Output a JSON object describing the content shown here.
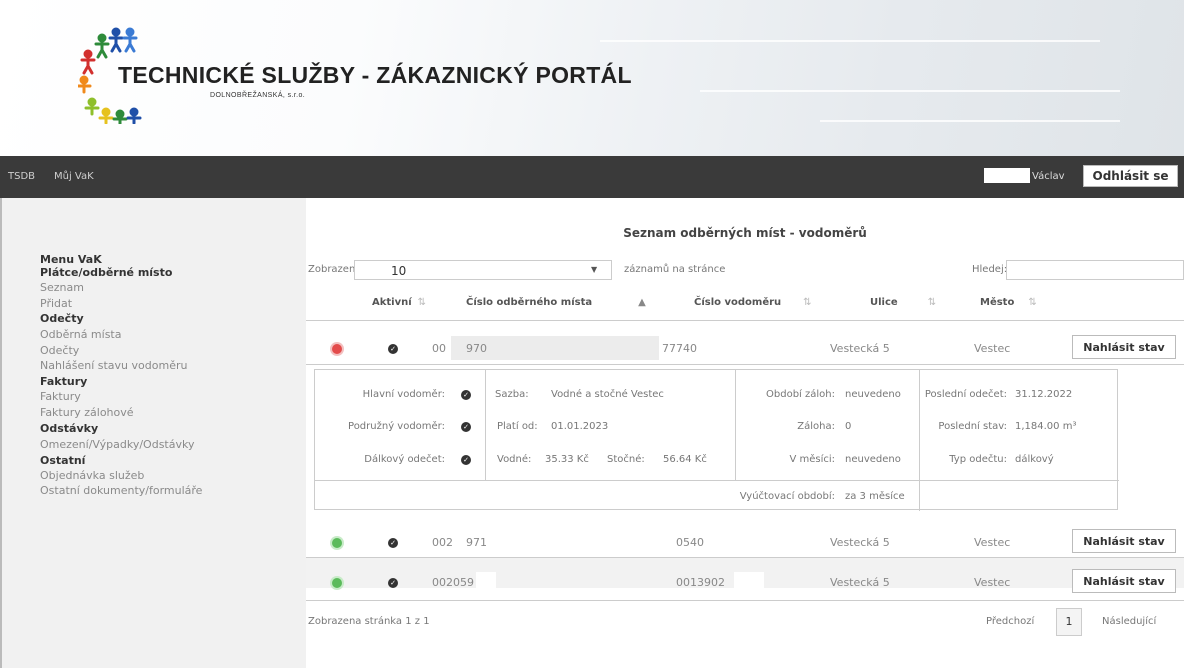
{
  "header": {
    "brand_title": "TECHNICKÉ SLUŽBY - ZÁKAZNICKÝ PORTÁL",
    "brand_subtitle": "DOLNOBŘEŽANSKÁ, s.r.o."
  },
  "navbar": {
    "items": [
      "TSDB",
      "Můj VaK"
    ],
    "user_name": "Václav",
    "logout_label": "Odhlásit se"
  },
  "sidebar": {
    "menu_title": "Menu VaK",
    "sections": [
      {
        "title": "Plátce/odběrné místo",
        "links": [
          "Seznam",
          "Přidat"
        ]
      },
      {
        "title": "Odečty",
        "links": [
          "Odběrná místa",
          "Odečty",
          "Nahlášení stavu vodoměru"
        ]
      },
      {
        "title": "Faktury",
        "links": [
          "Faktury",
          "Faktury zálohové"
        ]
      },
      {
        "title": "Odstávky",
        "links": [
          "Omezení/Výpadky/Odstávky"
        ]
      },
      {
        "title": "Ostatní",
        "links": [
          "Objednávka služeb",
          "Ostatní dokumenty/formuláře"
        ]
      }
    ]
  },
  "main": {
    "title": "Seznam odběrných míst - vodoměrů",
    "length": {
      "prefix": "Zobrazeno",
      "value": "10",
      "suffix": "záznamů na stránce"
    },
    "search_label": "Hledej:",
    "columns": [
      "Aktivní",
      "Číslo odběrného místa",
      "Číslo vodoměru",
      "Ulice",
      "Město"
    ],
    "rows": [
      {
        "status": "red",
        "id_a": "00",
        "id_b": "970",
        "meter": "77740",
        "street": "Vestecká 5",
        "city": "Vestec",
        "action": "Nahlásit stav"
      },
      {
        "status": "green",
        "id_a": "002",
        "id_b": "971",
        "meter": "0540",
        "street": "Vestecká 5",
        "city": "Vestec",
        "action": "Nahlásit stav"
      },
      {
        "status": "green",
        "id_a": "002059",
        "id_b": "",
        "meter": "0013902",
        "street": "Vestecká 5",
        "city": "Vestec",
        "action": "Nahlásit stav"
      }
    ],
    "detail": {
      "main_meter_label": "Hlavní vodoměr:",
      "sub_meter_label": "Podružný vodoměr:",
      "remote_label": "Dálkový odečet:",
      "rate_label": "Sazba:",
      "rate_value": "Vodné a stočné Vestec",
      "valid_from_label": "Platí od:",
      "valid_from_value": "01.01.2023",
      "water_label": "Vodné:",
      "water_value": "35.33 Kč",
      "sewage_label": "Stočné:",
      "sewage_value": "56.64 Kč",
      "deposit_period_label": "Období záloh:",
      "deposit_period_value": "neuvedeno",
      "deposit_label": "Záloha:",
      "deposit_value": "0",
      "month_label": "V měsíci:",
      "month_value": "neuvedeno",
      "last_reading_label": "Poslední odečet:",
      "last_reading_value": "31.12.2022",
      "last_state_label": "Poslední stav:",
      "last_state_value": "1,184.00 m³",
      "reading_type_label": "Typ odečtu:",
      "reading_type_value": "dálkový",
      "billing_period_label": "Vyúčtovací období:",
      "billing_period_value": "za 3 měsíce"
    },
    "footer": {
      "info": "Zobrazena stránka 1 z 1",
      "prev": "Předchozí",
      "page": "1",
      "next": "Následující"
    }
  }
}
